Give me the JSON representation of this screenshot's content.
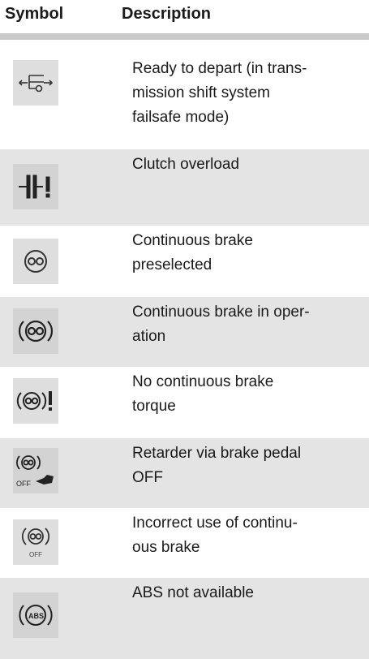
{
  "header": {
    "symbol_label": "Symbol",
    "description_label": "Description"
  },
  "rows": [
    {
      "icon": "ready-to-depart-icon",
      "description_lines": [
        "Ready to depart (in trans-",
        "mission shift system",
        "failsafe mode)"
      ]
    },
    {
      "icon": "clutch-overload-icon",
      "description_lines": [
        "Clutch overload"
      ]
    },
    {
      "icon": "continuous-brake-preselected-icon",
      "description_lines": [
        "Continuous brake",
        "preselected"
      ]
    },
    {
      "icon": "continuous-brake-operation-icon",
      "description_lines": [
        "Continuous brake in oper-",
        "ation"
      ]
    },
    {
      "icon": "no-continuous-brake-torque-icon",
      "description_lines": [
        "No continuous brake",
        "torque"
      ]
    },
    {
      "icon": "retarder-brake-pedal-off-icon",
      "icon_text": "OFF",
      "description_lines": [
        "Retarder via brake pedal",
        "OFF"
      ]
    },
    {
      "icon": "incorrect-continuous-brake-icon",
      "icon_text": "OFF",
      "description_lines": [
        "Incorrect use of continu-",
        "ous brake"
      ]
    },
    {
      "icon": "abs-not-available-icon",
      "icon_text": "ABS",
      "description_lines": [
        "ABS not available"
      ]
    }
  ]
}
